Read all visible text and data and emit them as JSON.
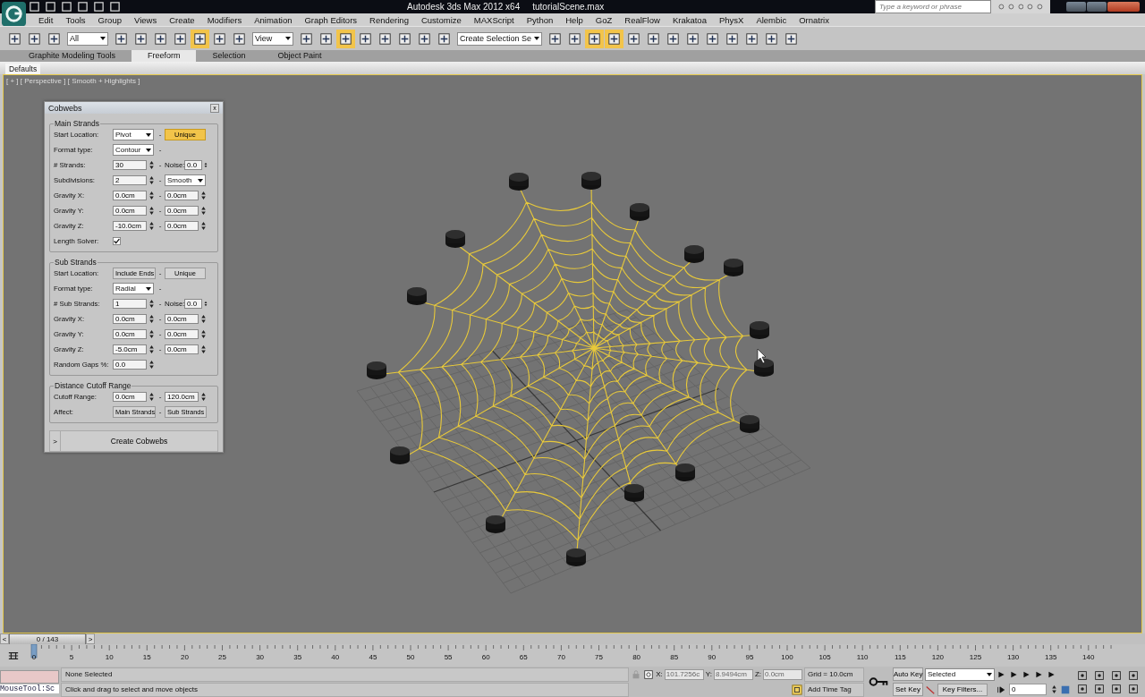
{
  "window": {
    "app_title": "Autodesk 3ds Max  2012 x64",
    "file_title": "tutorialScene.max",
    "search_placeholder": "Type a keyword or phrase"
  },
  "menu": [
    "Edit",
    "Tools",
    "Group",
    "Views",
    "Create",
    "Modifiers",
    "Animation",
    "Graph Editors",
    "Rendering",
    "Customize",
    "MAXScript",
    "Python",
    "Help",
    "GoZ",
    "RealFlow",
    "Krakatoa",
    "PhysX",
    "Alembic",
    "Ornatrix"
  ],
  "toolbar": [
    {
      "kind": "button",
      "active": false
    },
    {
      "kind": "button",
      "active": false
    },
    {
      "kind": "button",
      "active": false
    },
    {
      "kind": "dropdown",
      "value": "All"
    },
    {
      "kind": "button",
      "active": false
    },
    {
      "kind": "button",
      "active": false
    },
    {
      "kind": "button",
      "active": false
    },
    {
      "kind": "button",
      "active": false
    },
    {
      "kind": "button",
      "active": true
    },
    {
      "kind": "button",
      "active": false
    },
    {
      "kind": "button",
      "active": false
    },
    {
      "kind": "dropdown",
      "value": "View"
    },
    {
      "kind": "button",
      "active": false
    },
    {
      "kind": "button",
      "active": false
    },
    {
      "kind": "button",
      "active": true
    },
    {
      "kind": "button",
      "active": false
    },
    {
      "kind": "button",
      "active": false
    },
    {
      "kind": "button",
      "active": false
    },
    {
      "kind": "button",
      "active": false
    },
    {
      "kind": "button",
      "active": false
    },
    {
      "kind": "dropdown",
      "value": "Create Selection Se"
    },
    {
      "kind": "button",
      "active": false
    },
    {
      "kind": "button",
      "active": false
    },
    {
      "kind": "button",
      "active": true
    },
    {
      "kind": "button",
      "active": true
    },
    {
      "kind": "button",
      "active": false
    },
    {
      "kind": "button",
      "active": false
    },
    {
      "kind": "button",
      "active": false
    },
    {
      "kind": "button",
      "active": false
    },
    {
      "kind": "button",
      "active": false
    },
    {
      "kind": "button",
      "active": false
    },
    {
      "kind": "button",
      "active": false
    },
    {
      "kind": "button",
      "active": false
    },
    {
      "kind": "button",
      "active": false
    }
  ],
  "ribbon_tabs": [
    {
      "label": "Graphite Modeling Tools",
      "selected": false
    },
    {
      "label": "Freeform",
      "selected": true
    },
    {
      "label": "Selection",
      "selected": false
    },
    {
      "label": "Object Paint",
      "selected": false
    }
  ],
  "ribbon_panel": "Defaults",
  "viewport_label": "[ + ] [ Perspective ] [ Smooth + Highlights ]",
  "dialog": {
    "title": "Cobwebs",
    "close": "x",
    "groups": [
      {
        "title": "Main Strands",
        "rows": [
          {
            "label": "Start Location:",
            "left": {
              "kind": "dropdown",
              "value": "Pivot"
            },
            "dash": "-",
            "right": {
              "kind": "button",
              "label": "Unique",
              "pressed": true
            }
          },
          {
            "label": "Format type:",
            "left": {
              "kind": "dropdown",
              "value": "Contour"
            },
            "dash": "-"
          },
          {
            "label": "# Strands:",
            "left": {
              "kind": "spinner",
              "value": "30"
            },
            "dash": "-",
            "right": {
              "kind": "spinner",
              "label": "Noise:",
              "value": "0.0"
            }
          },
          {
            "label": "Subdivisions:",
            "left": {
              "kind": "spinner",
              "value": "2"
            },
            "dash": "-",
            "right": {
              "kind": "dropdown",
              "value": "Smooth"
            }
          },
          {
            "label": "Gravity X:",
            "left": {
              "kind": "spinner",
              "value": "0.0cm"
            },
            "dash": "-",
            "right": {
              "kind": "spinner",
              "value": "0.0cm"
            }
          },
          {
            "label": "Gravity Y:",
            "left": {
              "kind": "spinner",
              "value": "0.0cm"
            },
            "dash": "-",
            "right": {
              "kind": "spinner",
              "value": "0.0cm"
            }
          },
          {
            "label": "Gravity Z:",
            "left": {
              "kind": "spinner",
              "value": "-10.0cm"
            },
            "dash": "-",
            "right": {
              "kind": "spinner",
              "value": "0.0cm"
            }
          },
          {
            "label": "Length Solver:",
            "left": {
              "kind": "checkbox",
              "checked": true
            }
          }
        ]
      },
      {
        "title": "Sub Strands",
        "rows": [
          {
            "label": "Start Location:",
            "left": {
              "kind": "button",
              "label": "Include Ends",
              "pressed": false
            },
            "dash": "-",
            "right": {
              "kind": "button",
              "label": "Unique",
              "pressed": false
            }
          },
          {
            "label": "Format type:",
            "left": {
              "kind": "dropdown",
              "value": "Radial"
            },
            "dash": "-"
          },
          {
            "label": "# Sub Strands:",
            "left": {
              "kind": "spinner",
              "value": "1"
            },
            "dash": "-",
            "right": {
              "kind": "spinner",
              "label": "Noise:",
              "value": "0.0"
            }
          },
          {
            "label": "Gravity X:",
            "left": {
              "kind": "spinner",
              "value": "0.0cm"
            },
            "dash": "-",
            "right": {
              "kind": "spinner",
              "value": "0.0cm"
            }
          },
          {
            "label": "Gravity Y:",
            "left": {
              "kind": "spinner",
              "value": "0.0cm"
            },
            "dash": "-",
            "right": {
              "kind": "spinner",
              "value": "0.0cm"
            }
          },
          {
            "label": "Gravity Z:",
            "left": {
              "kind": "spinner",
              "value": "-5.0cm"
            },
            "dash": "-",
            "right": {
              "kind": "spinner",
              "value": "0.0cm"
            }
          },
          {
            "label": "Random Gaps %:",
            "left": {
              "kind": "spinner",
              "value": "0.0"
            }
          }
        ]
      },
      {
        "title": "Distance Cutoff Range",
        "rows": [
          {
            "label": "Cutoff Range:",
            "left": {
              "kind": "spinner",
              "value": "0.0cm"
            },
            "dash": "-",
            "right": {
              "kind": "spinner",
              "value": "120.0cm"
            }
          },
          {
            "label": "Affect:",
            "left": {
              "kind": "button",
              "label": "Main Strands",
              "pressed": false
            },
            "dash": "-",
            "right": {
              "kind": "button",
              "label": "Sub Strands",
              "pressed": false
            }
          }
        ]
      }
    ],
    "rollout": {
      "toggle": ">",
      "label": "Create Cobwebs"
    }
  },
  "timeline": {
    "prev": "<",
    "next": ">",
    "frame": "0 / 143",
    "labels": [
      "0",
      "5",
      "10",
      "15",
      "20",
      "25",
      "30",
      "35",
      "40",
      "45",
      "50",
      "55",
      "60",
      "65",
      "70",
      "75",
      "80",
      "85",
      "90",
      "95",
      "100",
      "105",
      "110",
      "115",
      "120",
      "125",
      "130",
      "135",
      "140"
    ]
  },
  "status": {
    "listener": "MouseTool:Sc",
    "selection": "None Selected",
    "prompt": "Click and drag to select and move objects",
    "x_label": "X:",
    "x": "101.7256c",
    "y_label": "Y:",
    "y": "8.9494cm",
    "z_label": "Z:",
    "z": "0.0cm",
    "grid": "Grid = 10.0cm",
    "add_time_tag": "Add Time Tag",
    "auto_key": "Auto Key",
    "set_key": "Set Key",
    "key_mode": "Selected",
    "key_filters": "Key Filters...",
    "current_frame": "0"
  }
}
